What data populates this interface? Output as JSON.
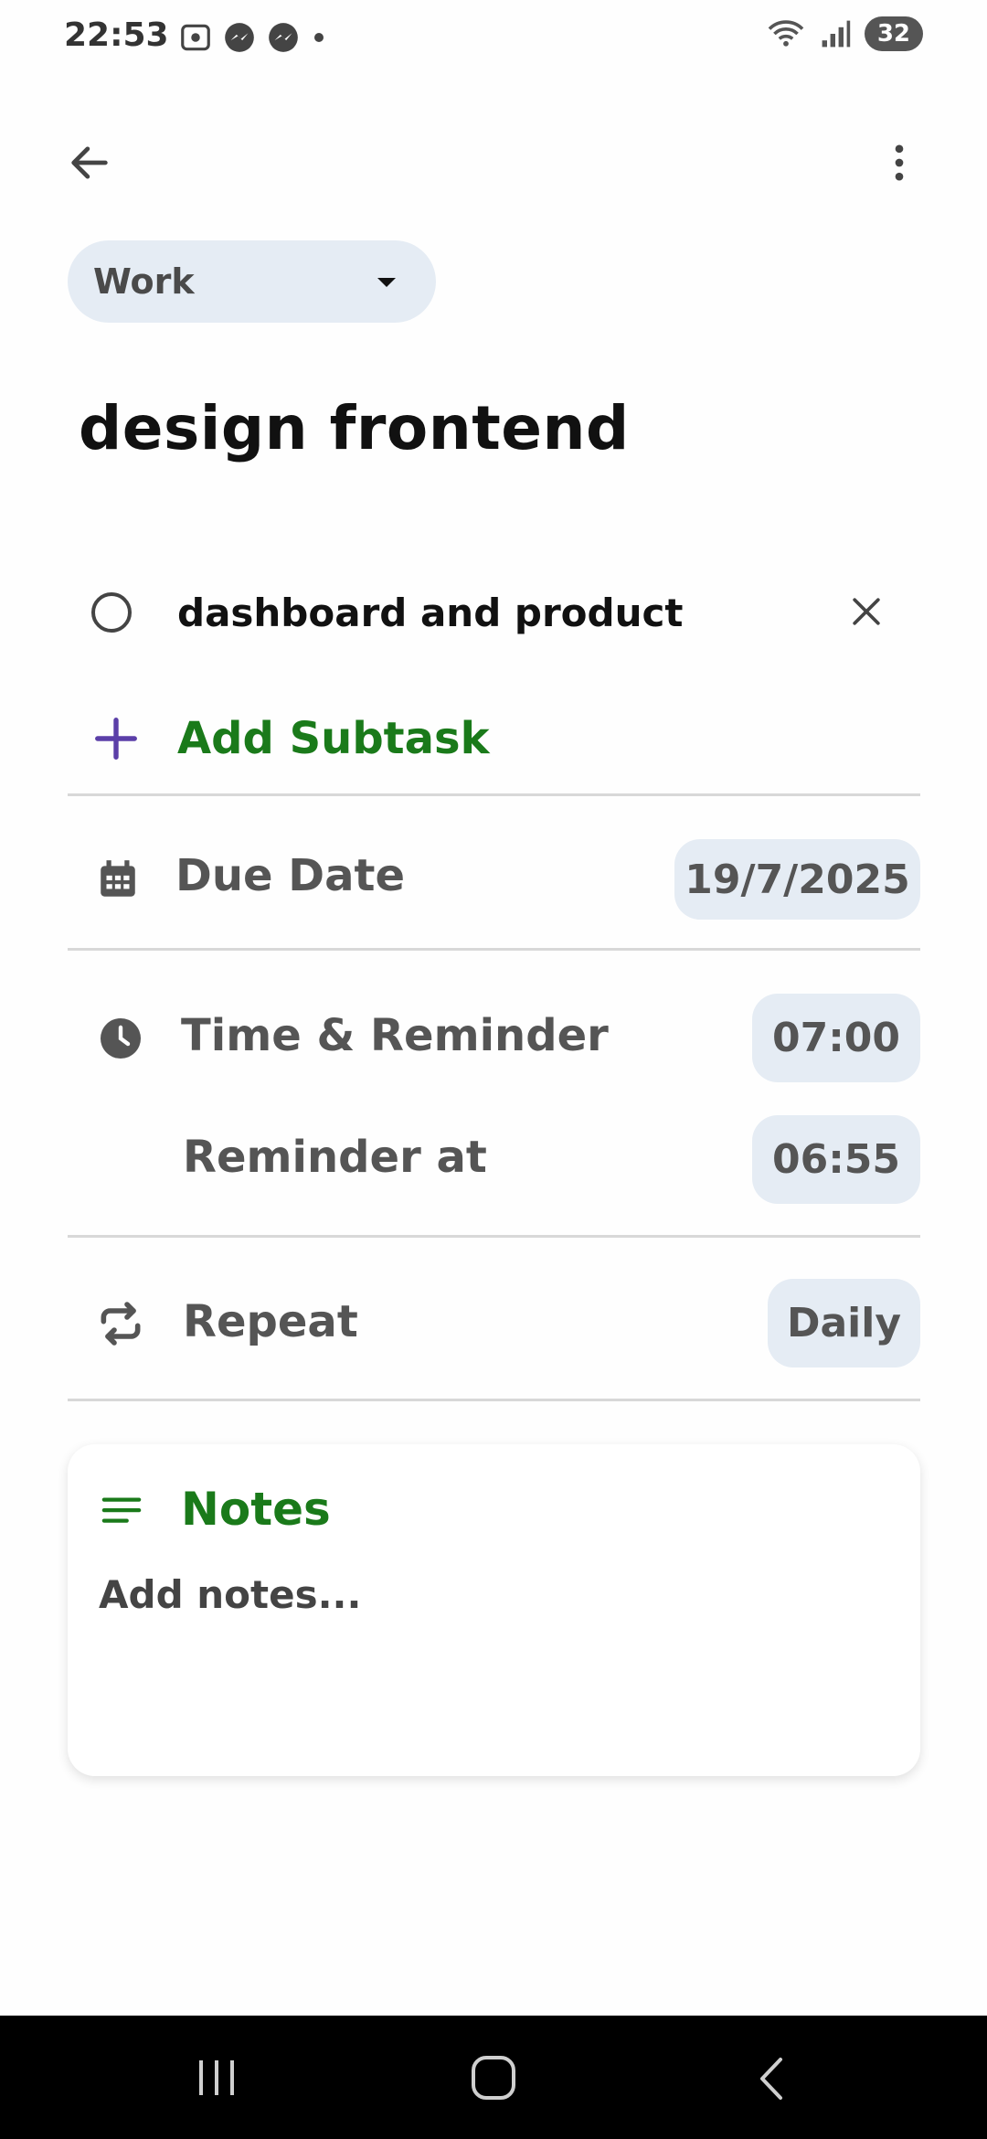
{
  "status_bar": {
    "time": "22:53",
    "battery": "32"
  },
  "header": {
    "category": "Work"
  },
  "task": {
    "title": "design frontend"
  },
  "subtasks": [
    {
      "label": "dashboard and product"
    }
  ],
  "add_subtask_label": "Add Subtask",
  "due_date": {
    "label": "Due Date",
    "value": "19/7/2025"
  },
  "time_reminder": {
    "label": "Time & Reminder",
    "value": "07:00"
  },
  "reminder_at": {
    "label": "Reminder at",
    "value": "06:55"
  },
  "repeat": {
    "label": "Repeat",
    "value": "Daily"
  },
  "notes": {
    "title": "Notes",
    "placeholder": "Add notes..."
  },
  "colors": {
    "accent_green": "#1a7a1a",
    "accent_purple": "#5b3fa8",
    "chip_bg": "#e5ecf4"
  }
}
